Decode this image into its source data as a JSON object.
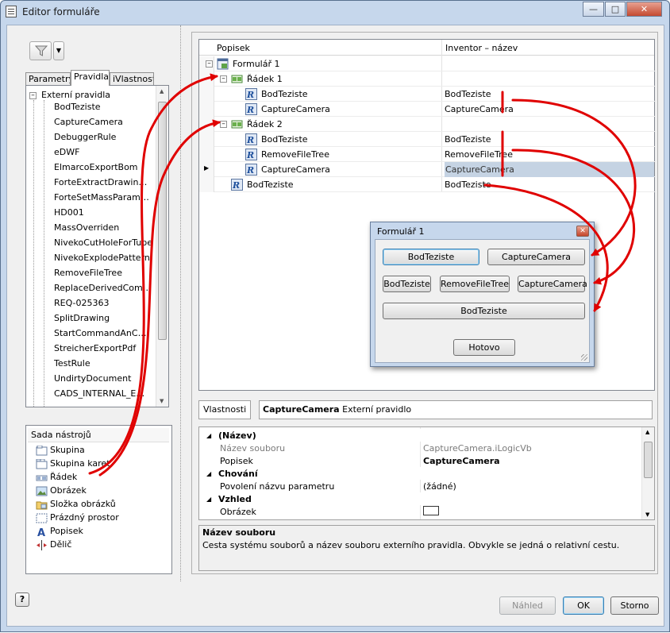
{
  "window": {
    "title": "Editor formuláře",
    "minimize": "—",
    "maximize": "□",
    "close": "✕"
  },
  "left": {
    "tabs": [
      "Parametry",
      "Pravidla",
      "iVlastnosti"
    ],
    "active_tab": "Pravidla",
    "rules_root": "Externí pravidla",
    "rules": [
      "BodTeziste",
      "CaptureCamera",
      "DebuggerRule",
      "eDWF",
      "ElmarcoExportBom",
      "ForteExtractDrawin…",
      "ForteSetMassParam…",
      "HD001",
      "MassOverriden",
      "NivekoCutHoleForTube",
      "NivekoExplodePattern",
      "RemoveFileTree",
      "ReplaceDerivedCom…",
      "REQ-025363",
      "SplitDrawing",
      "StartCommandAnC…",
      "StreicherExportPdf",
      "TestRule",
      "UndirtyDocument",
      "CADS_INTERNAL_E…"
    ],
    "toolbox_title": "Sada nástrojů",
    "toolbox_items": [
      "Skupina",
      "Skupina karet",
      "Řádek",
      "Obrázek",
      "Složka obrázků",
      "Prázdný prostor",
      "Popisek",
      "Dělič"
    ]
  },
  "grid": {
    "col1": "Popisek",
    "col2": "Inventor – název",
    "rows": [
      {
        "label": "Formulář 1",
        "name": ""
      },
      {
        "label": "Řádek 1",
        "name": ""
      },
      {
        "label": "BodTeziste",
        "name": "BodTeziste"
      },
      {
        "label": "CaptureCamera",
        "name": "CaptureCamera"
      },
      {
        "label": "Řádek 2",
        "name": ""
      },
      {
        "label": "BodTeziste",
        "name": "BodTeziste"
      },
      {
        "label": "RemoveFileTree",
        "name": "RemoveFileTree"
      },
      {
        "label": "CaptureCamera",
        "name": "CaptureCamera"
      },
      {
        "label": "BodTeziste",
        "name": "BodTeziste"
      }
    ],
    "current_row_marker": "▶"
  },
  "props": {
    "label": "Vlastnosti",
    "selected_name": "CaptureCamera",
    "selected_type": "Externí pravidlo",
    "cat_name": "(Název)",
    "file_key": "Název souboru",
    "file_val": "CaptureCamera.iLogicVb",
    "caption_key": "Popisek",
    "caption_val": "CaptureCamera",
    "cat_behavior": "Chování",
    "enable_key": "Povolení názvu parametru",
    "enable_val": "(žádné)",
    "cat_look": "Vzhled",
    "image_key": "Obrázek",
    "desc_title": "Název souboru",
    "desc_text": "Cesta systému souborů a název souboru externího pravidla. Obvykle se jedná o relativní cestu."
  },
  "preview": {
    "title": "Formulář 1",
    "row1": [
      "BodTeziste",
      "CaptureCamera"
    ],
    "row2": [
      "BodTeziste",
      "RemoveFileTree",
      "CaptureCamera"
    ],
    "row3": "BodTeziste",
    "done": "Hotovo"
  },
  "buttons": {
    "help": "?",
    "preview": "Náhled",
    "ok": "OK",
    "cancel": "Storno"
  },
  "colors": {
    "frame": "#c6d7ec",
    "selection": "#c5d3e3",
    "annotation_arrow": "#e00000"
  }
}
